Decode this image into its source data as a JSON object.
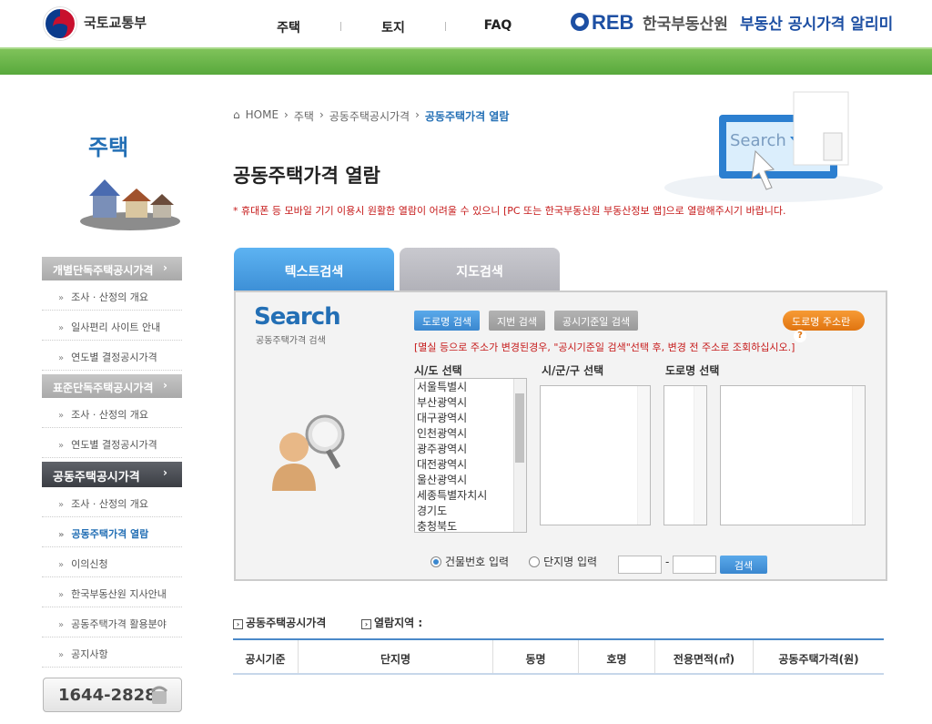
{
  "header": {
    "gov_name": "국토교통부",
    "nav": [
      "주택",
      "토지",
      "FAQ"
    ],
    "reb_logo_text": "REB",
    "reb_name": "한국부동산원",
    "service_name": "부동산 공시가격 알리미"
  },
  "sidebar": {
    "title": "주택",
    "groups": [
      {
        "label": "개별단독주택공시가격",
        "items": [
          "조사 · 산정의 개요",
          "일사편리 사이트 안내",
          "연도별 결정공시가격"
        ]
      },
      {
        "label": "표준단독주택공시가격",
        "items": [
          "조사 · 산정의 개요",
          "연도별 결정공시가격"
        ]
      },
      {
        "label": "공동주택공시가격",
        "items": [
          "조사 · 산정의 개요",
          "공동주택가격 열람",
          "이의신청",
          "한국부동산원 지사안내",
          "공동주택가격 활용분야",
          "공지사항"
        ]
      }
    ],
    "active_item": "공동주택가격 열람",
    "phone": "1644-2828"
  },
  "breadcrumb": [
    "HOME",
    "주택",
    "공동주택공시가격",
    "공동주택가격 열람"
  ],
  "page_title": "공동주택가격 열람",
  "notice": "* 휴대폰 등 모바일 기기 이용시 원활한 열람이 어려울 수 있으니 [PC 또는 한국부동산원 부동산정보 앱]으로 열람해주시기 바랍니다.",
  "hero_text": "Search",
  "tabs": [
    "텍스트검색",
    "지도검색"
  ],
  "search": {
    "logo": "Search",
    "subtitle": "공동주택가격 검색",
    "buttons": [
      "도로명 검색",
      "지번 검색",
      "공시기준일 검색"
    ],
    "help_button": "도로명 주소란",
    "help_icon": "?",
    "warning": "[멸실 등으로 주소가 변경된경우, \"공시기준일 검색\"선택 후, 변경 전 주소로 조회하십시오.]",
    "labels": {
      "sido": "시/도 선택",
      "sigungu": "시/군/구 선택",
      "road": "도로명 선택"
    },
    "sido_options": [
      "서울특별시",
      "부산광역시",
      "대구광역시",
      "인천광역시",
      "광주광역시",
      "대전광역시",
      "울산광역시",
      "세종특별자치시",
      "경기도",
      "충청북도"
    ],
    "radio_building": "건물번호 입력",
    "radio_complex": "단지명 입력",
    "dash": "-",
    "go_button": "검색"
  },
  "section": {
    "left": "공동주택공시가격",
    "right": "열람지역 :"
  },
  "table_headers": [
    "공시기준",
    "단지명",
    "동명",
    "호명",
    "전용면적(㎡)",
    "공동주택가격(원)"
  ],
  "colors": {
    "accent": "#236fb5",
    "green": "#58a93c",
    "warning": "#c61a1a",
    "orange": "#e07410"
  }
}
